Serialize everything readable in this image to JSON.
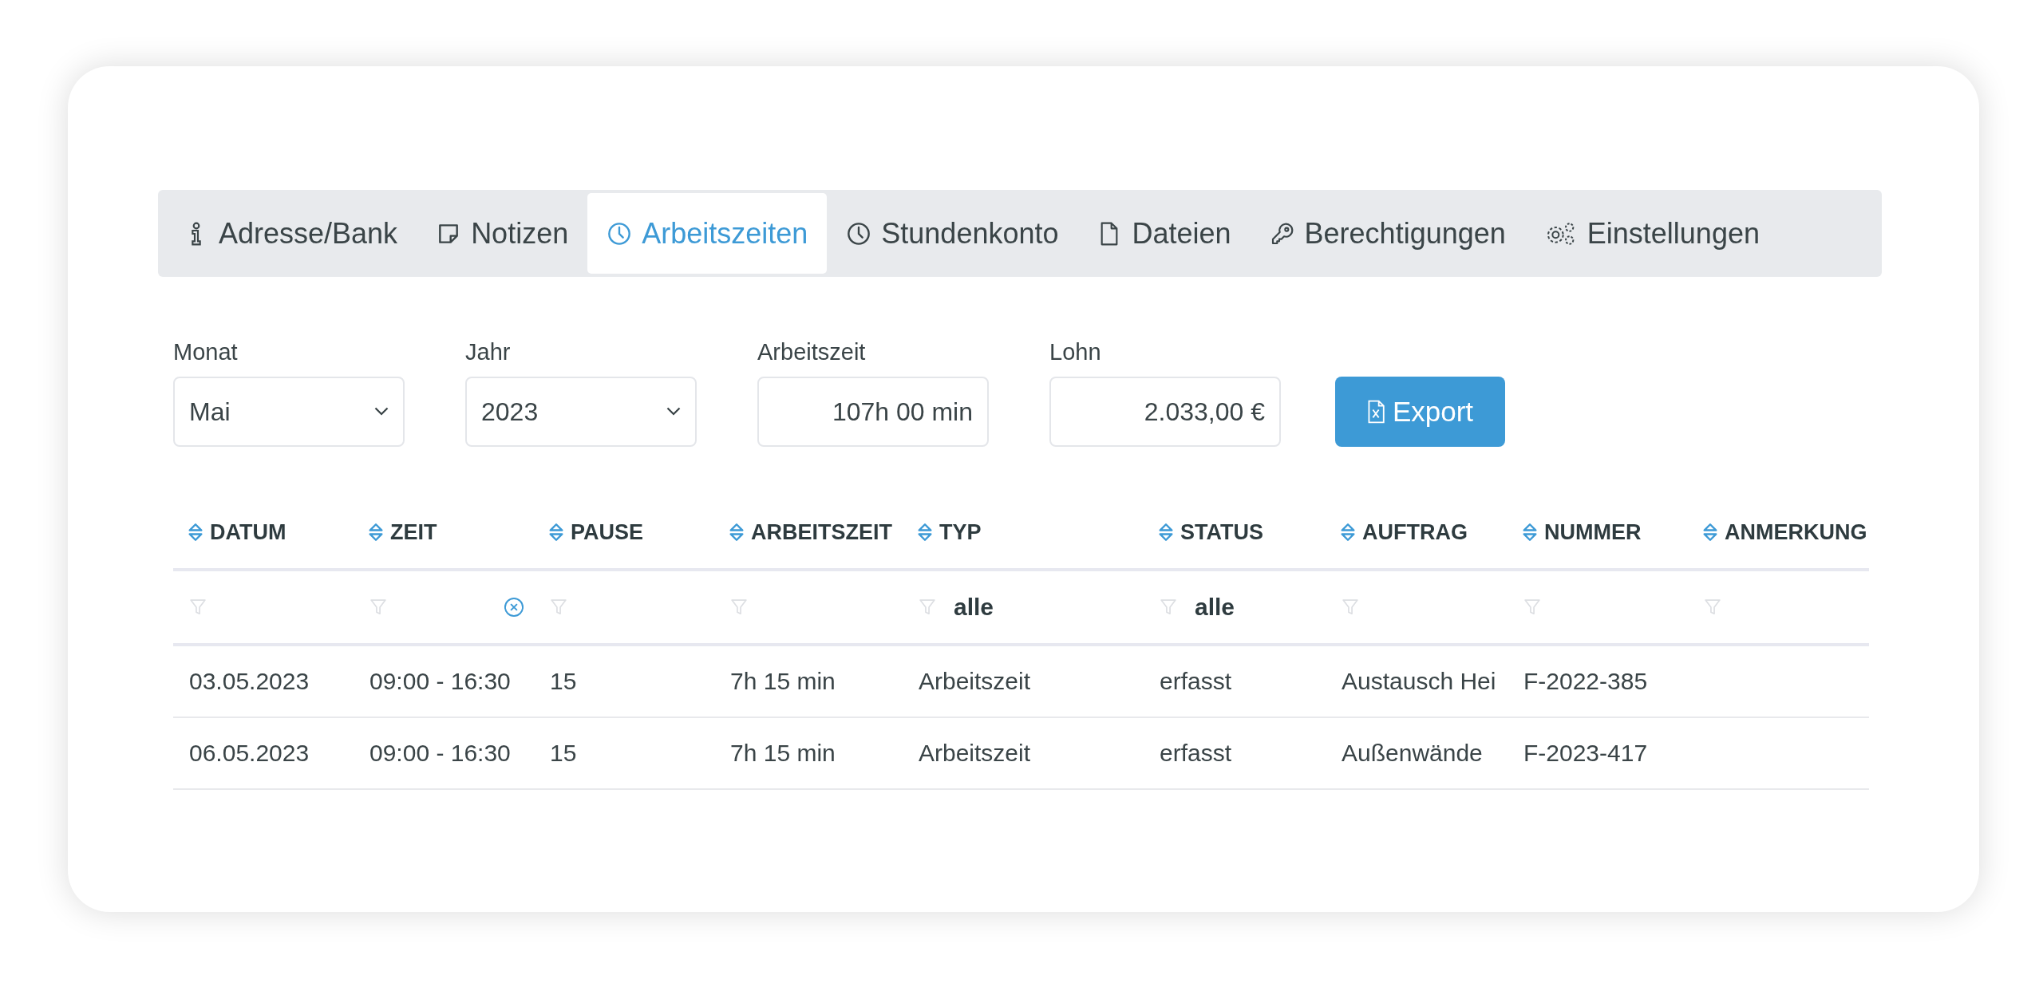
{
  "tabs": [
    {
      "label": "Adresse/Bank",
      "kind": "info",
      "selected": false
    },
    {
      "label": "Notizen",
      "kind": "note",
      "selected": false
    },
    {
      "label": "Arbeitszeiten",
      "kind": "clock",
      "selected": true
    },
    {
      "label": "Stundenkonto",
      "kind": "clock",
      "selected": false
    },
    {
      "label": "Dateien",
      "kind": "file",
      "selected": false
    },
    {
      "label": "Berechtigungen",
      "kind": "key",
      "selected": false
    },
    {
      "label": "Einstellungen",
      "kind": "gears",
      "selected": false
    }
  ],
  "fields": [
    {
      "label": "Monat",
      "kind": "select",
      "value": "Mai"
    },
    {
      "label": "Jahr",
      "kind": "select",
      "value": "2023"
    },
    {
      "label": "Arbeitszeit",
      "kind": "text",
      "value": "107h 00 min"
    },
    {
      "label": "Lohn",
      "kind": "text",
      "value": "2.033,00 €"
    }
  ],
  "export_button": {
    "label": "Export"
  },
  "table": {
    "columns": [
      {
        "label": "DATUM",
        "clearable": false
      },
      {
        "label": "ZEIT",
        "clearable": true
      },
      {
        "label": "PAUSE",
        "clearable": false
      },
      {
        "label": "ARBEITSZEIT",
        "clearable": false
      },
      {
        "label": "TYP",
        "clearable": false,
        "filter": "alle"
      },
      {
        "label": "STATUS",
        "clearable": false,
        "filter": "alle"
      },
      {
        "label": "AUFTRAG",
        "clearable": false
      },
      {
        "label": "NUMMER",
        "clearable": false
      },
      {
        "label": "ANMERKUNG",
        "clearable": false
      }
    ],
    "rows": [
      {
        "cells": [
          "03.05.2023",
          "09:00 - 16:30",
          "15",
          "7h 15 min",
          "Arbeitszeit",
          "erfasst",
          "Austausch Hei",
          "F-2022-385"
        ]
      },
      {
        "cells": [
          "06.05.2023",
          "09:00 - 16:30",
          "15",
          "7h 15 min",
          "Arbeitszeit",
          "erfasst",
          "Außenwände",
          "F-2023-417"
        ]
      }
    ]
  }
}
